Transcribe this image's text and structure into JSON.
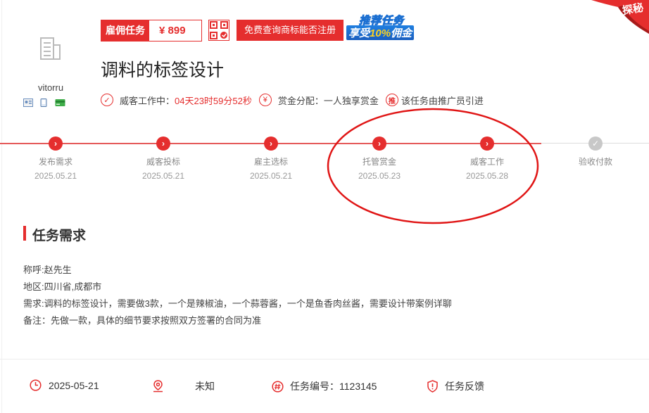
{
  "user": {
    "name": "vitorru"
  },
  "price": {
    "label": "雇佣任务",
    "value": "¥ 899"
  },
  "top_button": "免费查询商标能否注册",
  "promo": {
    "line1": "推荐任务",
    "line2_prefix": "享受",
    "line2_highlight": "10%",
    "line2_suffix": "佣金"
  },
  "corner_badge": "探秘",
  "task_title": "调料的标签设计",
  "status": {
    "working_label": "威客工作中：",
    "countdown": "04天23时59分52秒",
    "reward_label": "赏金分配：",
    "reward_value": "一人独享赏金",
    "promoter_icon_text": "推",
    "promoter_text": "该任务由推广员引进"
  },
  "progress": [
    {
      "name": "发布需求",
      "date": "2025.05.21",
      "done": true
    },
    {
      "name": "威客投标",
      "date": "2025.05.21",
      "done": true
    },
    {
      "name": "雇主选标",
      "date": "2025.05.21",
      "done": true
    },
    {
      "name": "托管赏金",
      "date": "2025.05.23",
      "done": true
    },
    {
      "name": "威客工作",
      "date": "2025.05.28",
      "done": true
    },
    {
      "name": "验收付款",
      "date": "",
      "done": false
    }
  ],
  "requirements": {
    "heading": "任务需求",
    "lines": [
      "称呼:赵先生",
      "地区:四川省,成都市",
      "需求:调料的标签设计，需要做3款，一个是辣椒油，一个蒜蓉酱，一个是鱼香肉丝酱，需要设计带案例详聊",
      "备注：先做一款，具体的细节要求按照双方签署的合同为准"
    ]
  },
  "footer": {
    "date": "2025-05-21",
    "location": "未知",
    "task_number": "任务编号：1123145",
    "feedback": "任务反馈"
  },
  "colors": {
    "accent": "#e52e2e",
    "disabled": "#c8c8c8"
  }
}
